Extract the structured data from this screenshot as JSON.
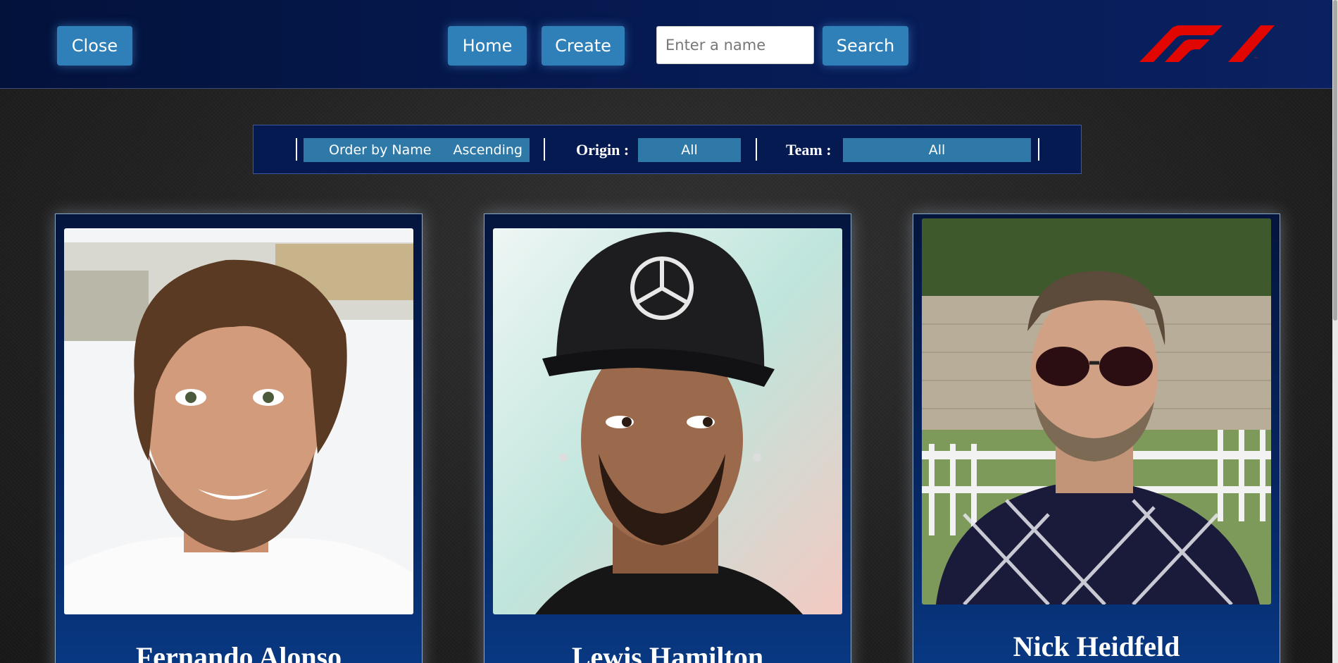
{
  "nav": {
    "close_label": "Close",
    "home_label": "Home",
    "create_label": "Create",
    "search_placeholder": "Enter a name",
    "search_value": "",
    "search_label": "Search",
    "logo_color": "#e10600"
  },
  "filters": {
    "order_label": "Order by Name",
    "direction_label": "Ascending",
    "origin_label": "Origin :",
    "origin_value": "All",
    "team_label": "Team :",
    "team_value": "All",
    "accent": "#2f79a8"
  },
  "drivers": [
    {
      "name": "Fernando Alonso"
    },
    {
      "name": "Lewis Hamilton"
    },
    {
      "name": "Nick Heidfeld"
    }
  ]
}
